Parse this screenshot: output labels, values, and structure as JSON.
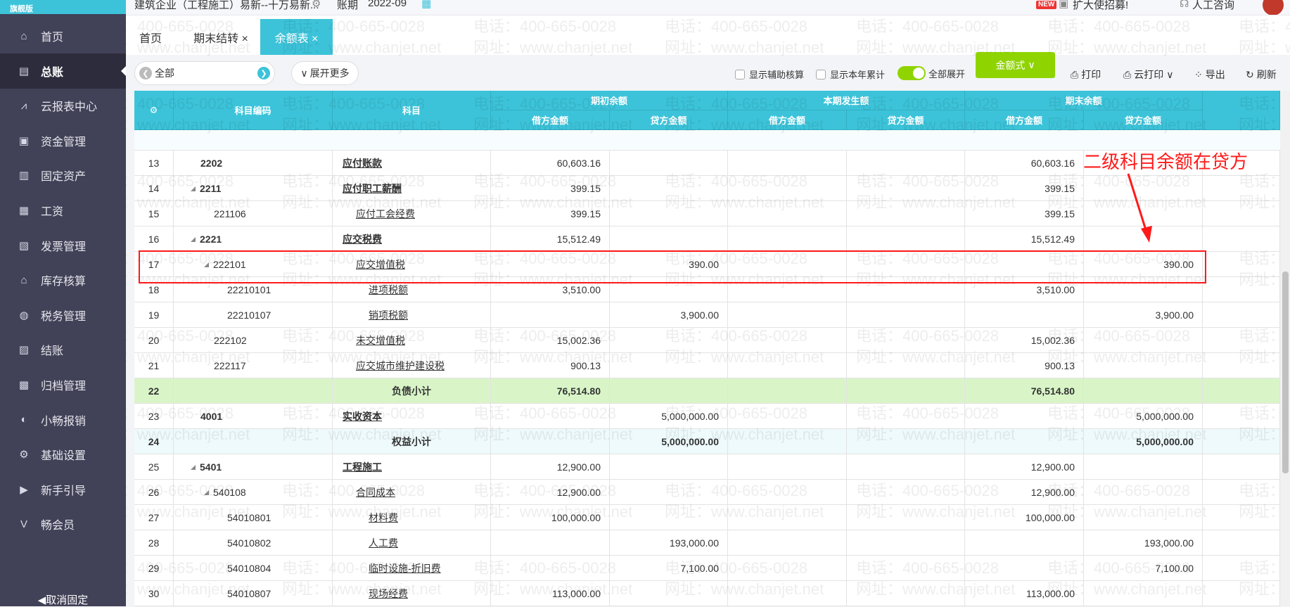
{
  "app": {
    "edition": "旗舰版",
    "company": "建筑企业（工程施工）易新--十万易新...",
    "period_label": "账期",
    "period": "2022-09",
    "promo": "扩大使招募!",
    "promo_badge": "NEW",
    "support": "人工咨询"
  },
  "sidebar": {
    "items": [
      {
        "label": "首页",
        "icon": "home-icon",
        "glyph": "⌂"
      },
      {
        "label": "总账",
        "icon": "ledger-icon",
        "glyph": "▤",
        "active": true
      },
      {
        "label": "云报表中心",
        "icon": "chart-icon",
        "glyph": "⩘"
      },
      {
        "label": "资金管理",
        "icon": "money-icon",
        "glyph": "▣"
      },
      {
        "label": "固定资产",
        "icon": "asset-icon",
        "glyph": "▥"
      },
      {
        "label": "工资",
        "icon": "salary-icon",
        "glyph": "▦"
      },
      {
        "label": "发票管理",
        "icon": "invoice-icon",
        "glyph": "▧"
      },
      {
        "label": "库存核算",
        "icon": "inventory-icon",
        "glyph": "⌂"
      },
      {
        "label": "税务管理",
        "icon": "tax-icon",
        "glyph": "◍"
      },
      {
        "label": "结账",
        "icon": "checkout-icon",
        "glyph": "▨"
      },
      {
        "label": "归档管理",
        "icon": "archive-icon",
        "glyph": "▩"
      },
      {
        "label": "小畅报销",
        "icon": "reimburse-icon",
        "glyph": "◐"
      },
      {
        "label": "基础设置",
        "icon": "settings-icon",
        "glyph": "⚙"
      },
      {
        "label": "新手引导",
        "icon": "guide-icon",
        "glyph": "▶"
      },
      {
        "label": "畅会员",
        "icon": "vip-icon",
        "glyph": "V"
      }
    ],
    "unpin": "◀取消固定"
  },
  "tabs": [
    {
      "label": "首页"
    },
    {
      "label": "期末结转 ×"
    },
    {
      "label": "余额表 ×"
    }
  ],
  "toolbar": {
    "filter_value": "全部",
    "expand_more": "展开更多",
    "show_aux": "显示辅助核算",
    "show_ytd": "显示本年累计",
    "expand_all": "全部展开",
    "expand_all_on": true,
    "format": "金额式",
    "print": "打印",
    "cloud_print": "云打印",
    "export": "导出",
    "refresh": "刷新"
  },
  "table": {
    "headers": {
      "code": "科目编码",
      "subject": "科目",
      "opening": "期初余额",
      "current": "本期发生额",
      "closing": "期末余额",
      "debit": "借方金额",
      "credit": "贷方金额"
    },
    "rows": [
      {
        "no": "13",
        "code": "2202",
        "name": "应付账款",
        "level": 1,
        "v": [
          "60,603.16",
          "",
          "",
          "",
          "60,603.16",
          ""
        ]
      },
      {
        "no": "14",
        "code": "2211",
        "name": "应付职工薪酬",
        "level": 1,
        "expand": true,
        "v": [
          "399.15",
          "",
          "",
          "",
          "399.15",
          ""
        ]
      },
      {
        "no": "15",
        "code": "221106",
        "name": "应付工会经费",
        "level": 2,
        "v": [
          "399.15",
          "",
          "",
          "",
          "399.15",
          ""
        ]
      },
      {
        "no": "16",
        "code": "2221",
        "name": "应交税费",
        "level": 1,
        "expand": true,
        "v": [
          "15,512.49",
          "",
          "",
          "",
          "15,512.49",
          ""
        ]
      },
      {
        "no": "17",
        "code": "222101",
        "name": "应交增值税",
        "level": 2,
        "expand": true,
        "v": [
          "",
          "390.00",
          "",
          "",
          "",
          "390.00"
        ]
      },
      {
        "no": "18",
        "code": "22210101",
        "name": "进项税额",
        "level": 3,
        "v": [
          "3,510.00",
          "",
          "",
          "",
          "3,510.00",
          ""
        ]
      },
      {
        "no": "19",
        "code": "22210107",
        "name": "销项税额",
        "level": 3,
        "v": [
          "",
          "3,900.00",
          "",
          "",
          "",
          "3,900.00"
        ]
      },
      {
        "no": "20",
        "code": "222102",
        "name": "未交增值税",
        "level": 2,
        "v": [
          "15,002.36",
          "",
          "",
          "",
          "15,002.36",
          ""
        ]
      },
      {
        "no": "21",
        "code": "222117",
        "name": "应交城市维护建设税",
        "level": 2,
        "v": [
          "900.13",
          "",
          "",
          "",
          "900.13",
          ""
        ]
      },
      {
        "no": "22",
        "code": "",
        "name": "负债小计",
        "subtotal": "liability",
        "v": [
          "76,514.80",
          "",
          "",
          "",
          "76,514.80",
          ""
        ]
      },
      {
        "no": "23",
        "code": "4001",
        "name": "实收资本",
        "level": 1,
        "v": [
          "",
          "5,000,000.00",
          "",
          "",
          "",
          "5,000,000.00"
        ]
      },
      {
        "no": "24",
        "code": "",
        "name": "权益小计",
        "subtotal": "equity",
        "v": [
          "",
          "5,000,000.00",
          "",
          "",
          "",
          "5,000,000.00"
        ]
      },
      {
        "no": "25",
        "code": "5401",
        "name": "工程施工",
        "level": 1,
        "expand": true,
        "v": [
          "12,900.00",
          "",
          "",
          "",
          "12,900.00",
          ""
        ]
      },
      {
        "no": "26",
        "code": "540108",
        "name": "合同成本",
        "level": 2,
        "expand": true,
        "v": [
          "12,900.00",
          "",
          "",
          "",
          "12,900.00",
          ""
        ]
      },
      {
        "no": "27",
        "code": "54010801",
        "name": "材料费",
        "level": 3,
        "v": [
          "100,000.00",
          "",
          "",
          "",
          "100,000.00",
          ""
        ]
      },
      {
        "no": "28",
        "code": "54010802",
        "name": "人工费",
        "level": 3,
        "v": [
          "",
          "193,000.00",
          "",
          "",
          "",
          "193,000.00"
        ]
      },
      {
        "no": "29",
        "code": "54010804",
        "name": "临时设施-折旧费",
        "level": 3,
        "v": [
          "",
          "7,100.00",
          "",
          "",
          "",
          "7,100.00"
        ]
      },
      {
        "no": "30",
        "code": "54010807",
        "name": "现场经费",
        "level": 3,
        "v": [
          "113,000.00",
          "",
          "",
          "",
          "113,000.00",
          ""
        ]
      }
    ]
  },
  "annotation": {
    "text": "二级科目余额在贷方",
    "color": "#ff1a1a"
  },
  "watermark": {
    "phone": "电话：400-665-0028",
    "site": "网址：www.chanjet.net"
  },
  "colors": {
    "accent": "#3cc3d9",
    "green": "#8fd400",
    "liability_row": "#d9f5c8",
    "equity_row": "#eefafc"
  }
}
